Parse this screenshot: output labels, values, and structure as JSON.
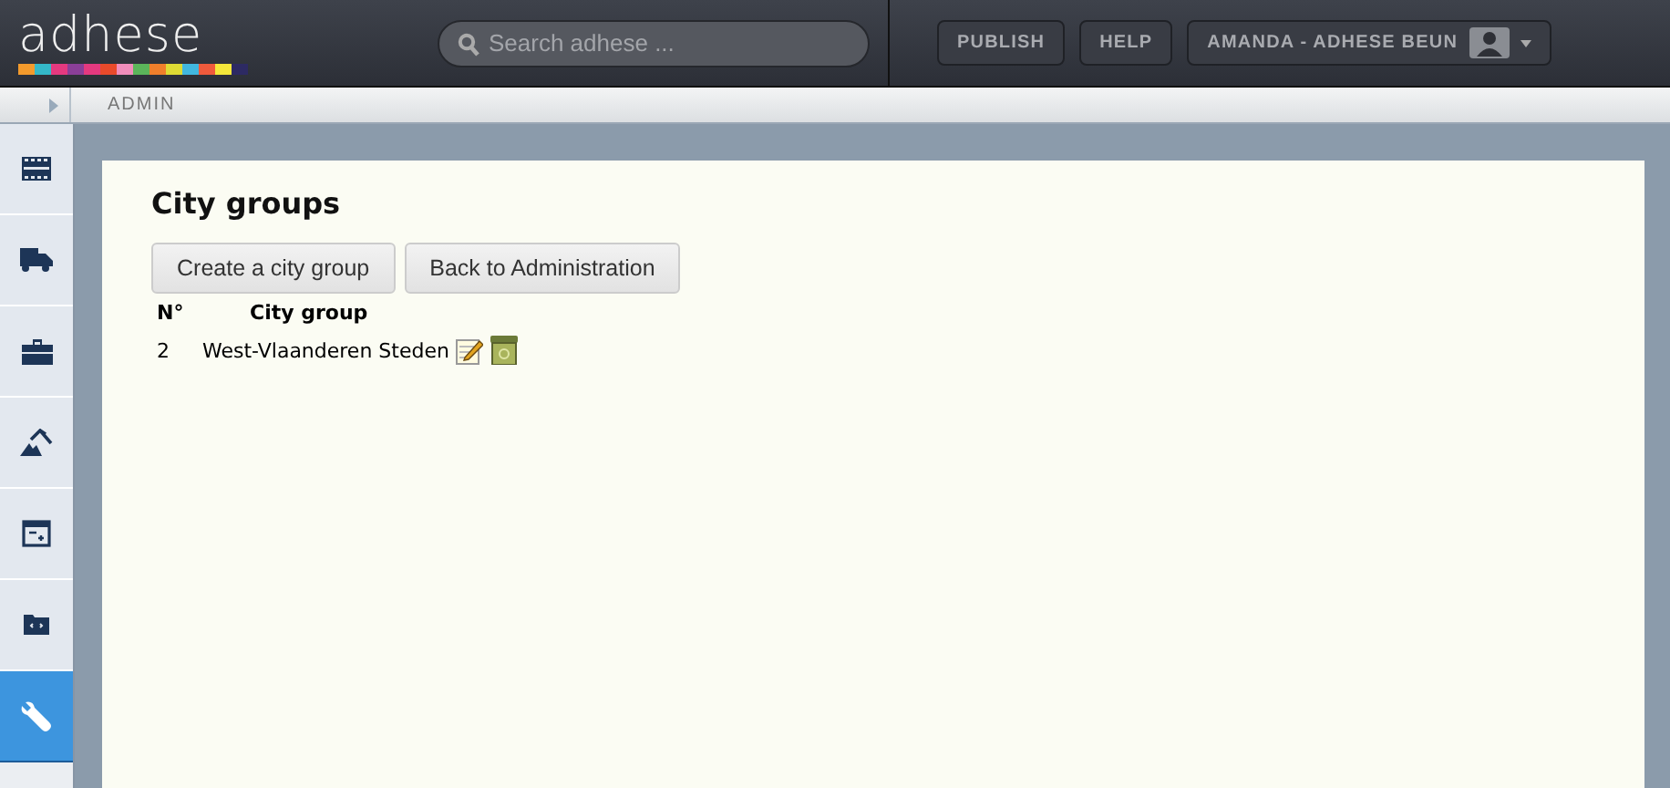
{
  "header": {
    "logo": "adhese",
    "search": {
      "placeholder": "Search adhese ..."
    },
    "buttons": [
      "PUBLISH",
      "HELP"
    ],
    "user": "AMANDA - ADHESE BEUN"
  },
  "breadcrumb": "ADMIN",
  "sidebar": {
    "items": [
      {
        "selected": false
      },
      {
        "selected": false
      },
      {
        "selected": false
      },
      {
        "selected": false
      },
      {
        "selected": false
      },
      {
        "selected": false
      },
      {
        "selected": true
      }
    ]
  },
  "page": {
    "title": "City groups",
    "buttons": [
      "Create a city group",
      "Back to Administration"
    ],
    "table": {
      "columns": [
        "N°",
        "City group"
      ],
      "rows": [
        {
          "number": "2",
          "name": "West-Vlaanderen Steden"
        }
      ]
    }
  }
}
